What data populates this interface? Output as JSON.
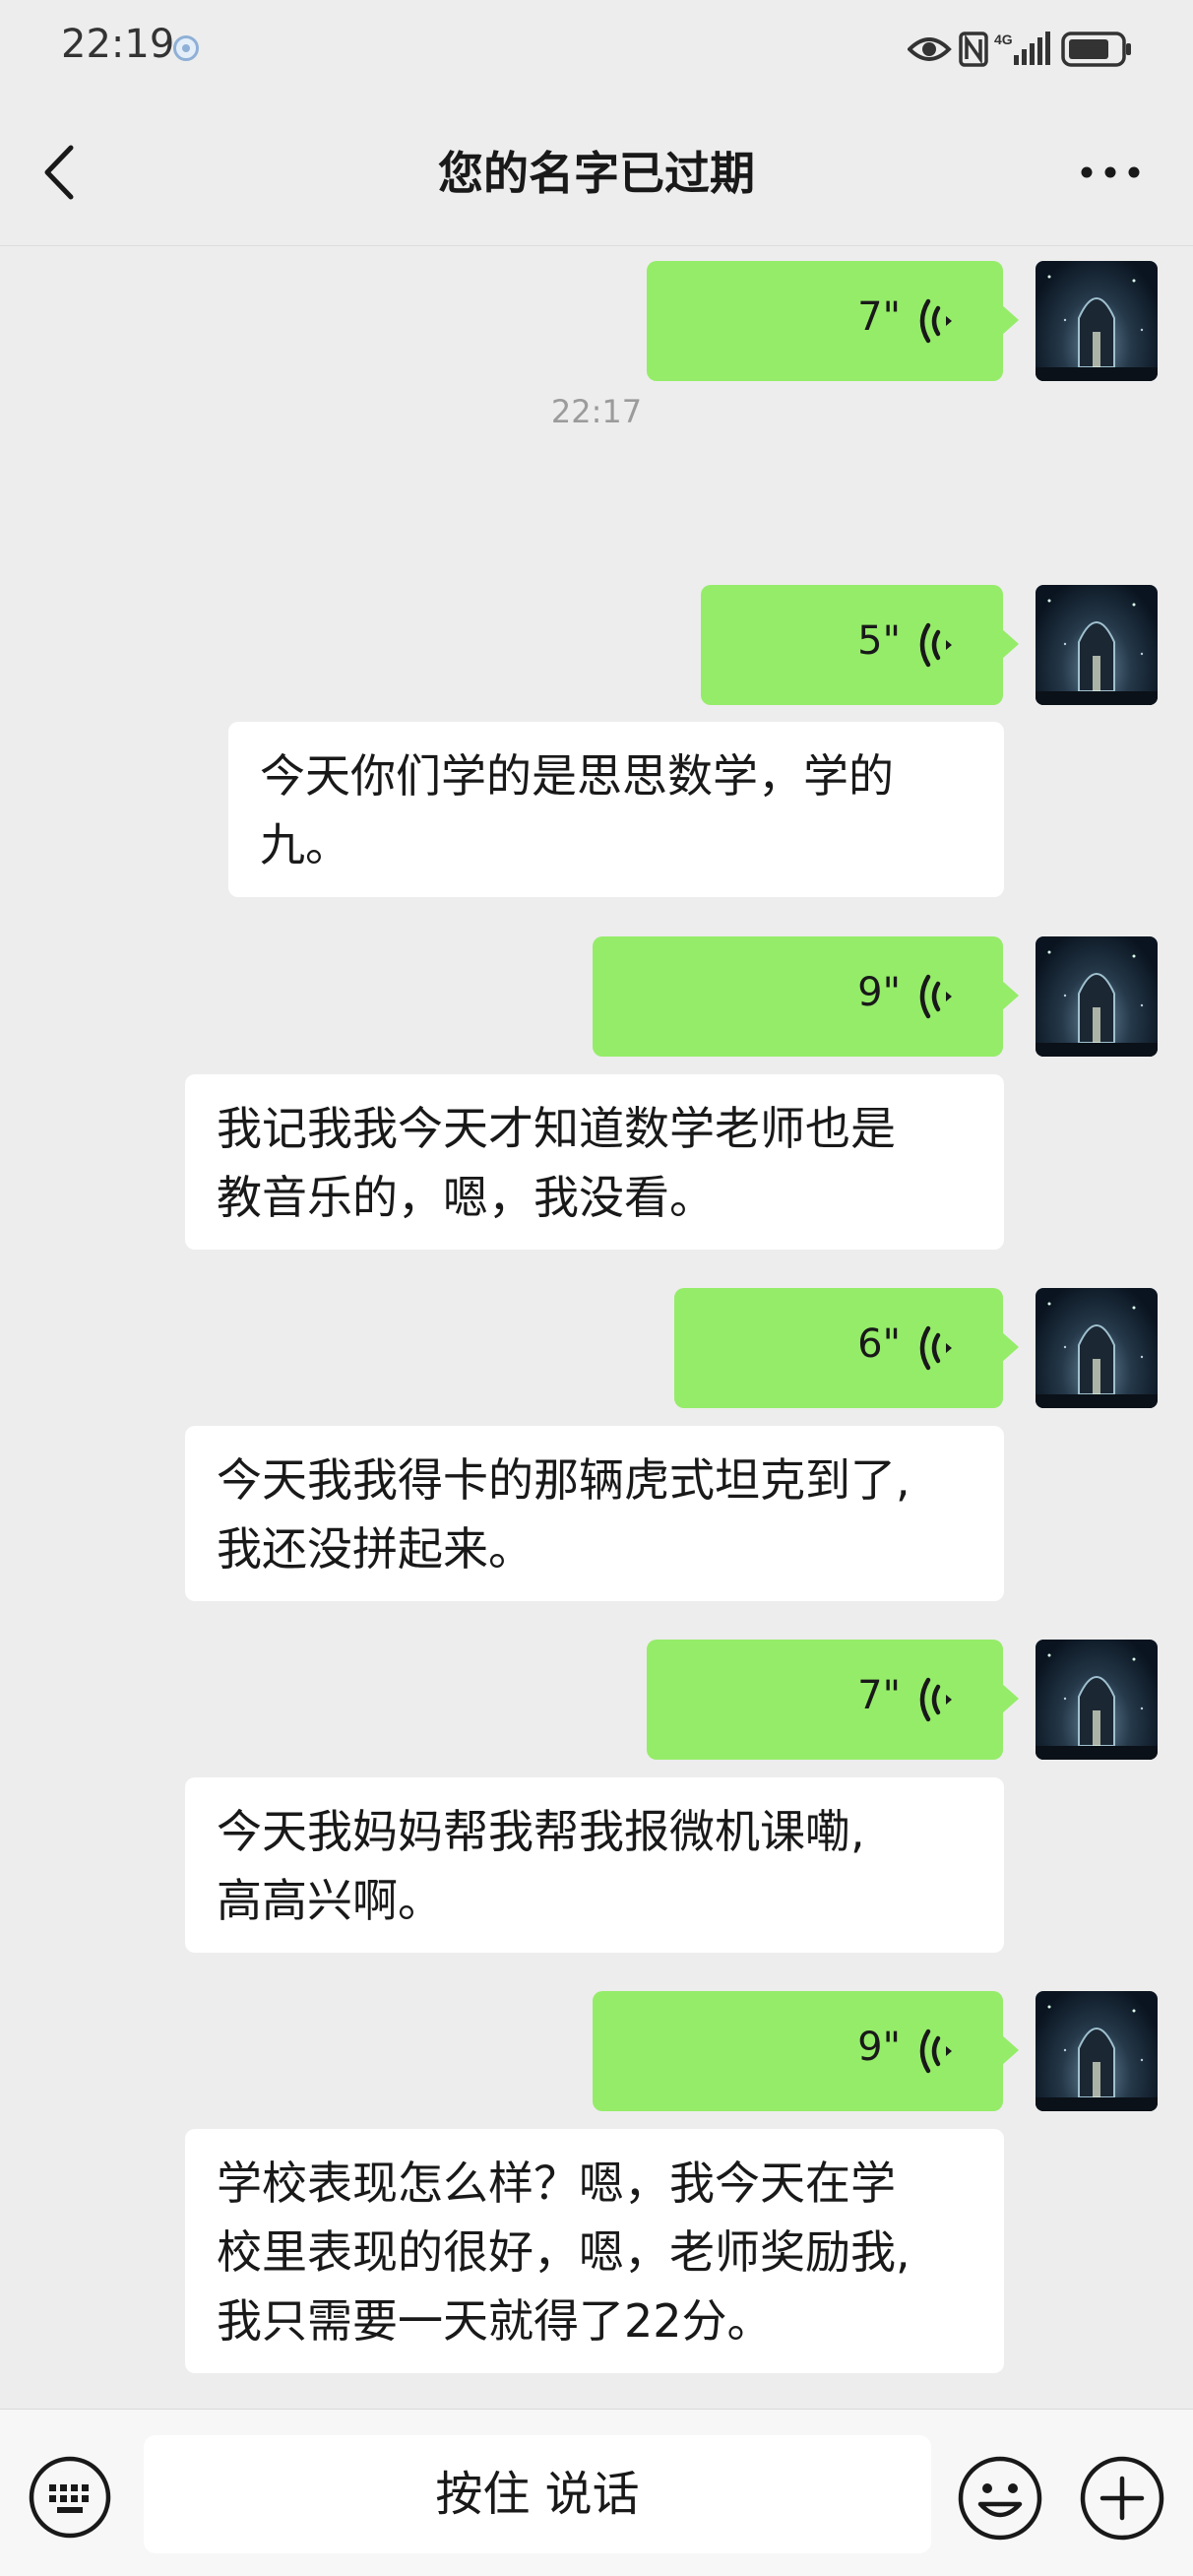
{
  "status_bar": {
    "time": "22:19",
    "icons": [
      "location-dot-icon",
      "eye-icon",
      "nfc-icon",
      "signal-4g-icon",
      "battery-icon"
    ],
    "network_label": "4G"
  },
  "header": {
    "title": "您的名字已过期",
    "back_icon": "chevron-left-icon",
    "more_icon": "more-dots-icon"
  },
  "messages": [
    {
      "type": "voice",
      "from": "me",
      "duration": "7\""
    },
    {
      "type": "timestamp",
      "text": "22:17"
    },
    {
      "type": "voice",
      "from": "me",
      "duration": "5\""
    },
    {
      "type": "text",
      "from": "me",
      "lines": [
        "今天你们学的是思思数学，学的",
        "九。"
      ]
    },
    {
      "type": "voice",
      "from": "me",
      "duration": "9\""
    },
    {
      "type": "text",
      "from": "me",
      "lines": [
        "我记我我今天才知道数学老师也是",
        "教音乐的，嗯，我没看。"
      ]
    },
    {
      "type": "voice",
      "from": "me",
      "duration": "6\""
    },
    {
      "type": "text",
      "from": "me",
      "lines": [
        "今天我我得卡的那辆虎式坦克到了,",
        "我还没拼起来。"
      ]
    },
    {
      "type": "voice",
      "from": "me",
      "duration": "7\""
    },
    {
      "type": "text",
      "from": "me",
      "lines": [
        "今天我妈妈帮我帮我报微机课嘞,",
        "高高兴啊。"
      ]
    },
    {
      "type": "voice",
      "from": "me",
      "duration": "9\""
    },
    {
      "type": "text",
      "from": "me",
      "lines": [
        "学校表现怎么样？嗯，我今天在学",
        "校里表现的很好，嗯，老师奖励我,",
        "我只需要一天就得了22分。"
      ]
    }
  ],
  "bottom_bar": {
    "hold_to_talk": "按住 说话",
    "keyboard_icon": "keyboard-icon",
    "emoji_icon": "emoji-icon",
    "plus_icon": "plus-circle-icon"
  },
  "colors": {
    "background": "#ededed",
    "my_bubble": "#95ec69",
    "text_bubble": "#ffffff",
    "timestamp": "#9b9b9b"
  }
}
